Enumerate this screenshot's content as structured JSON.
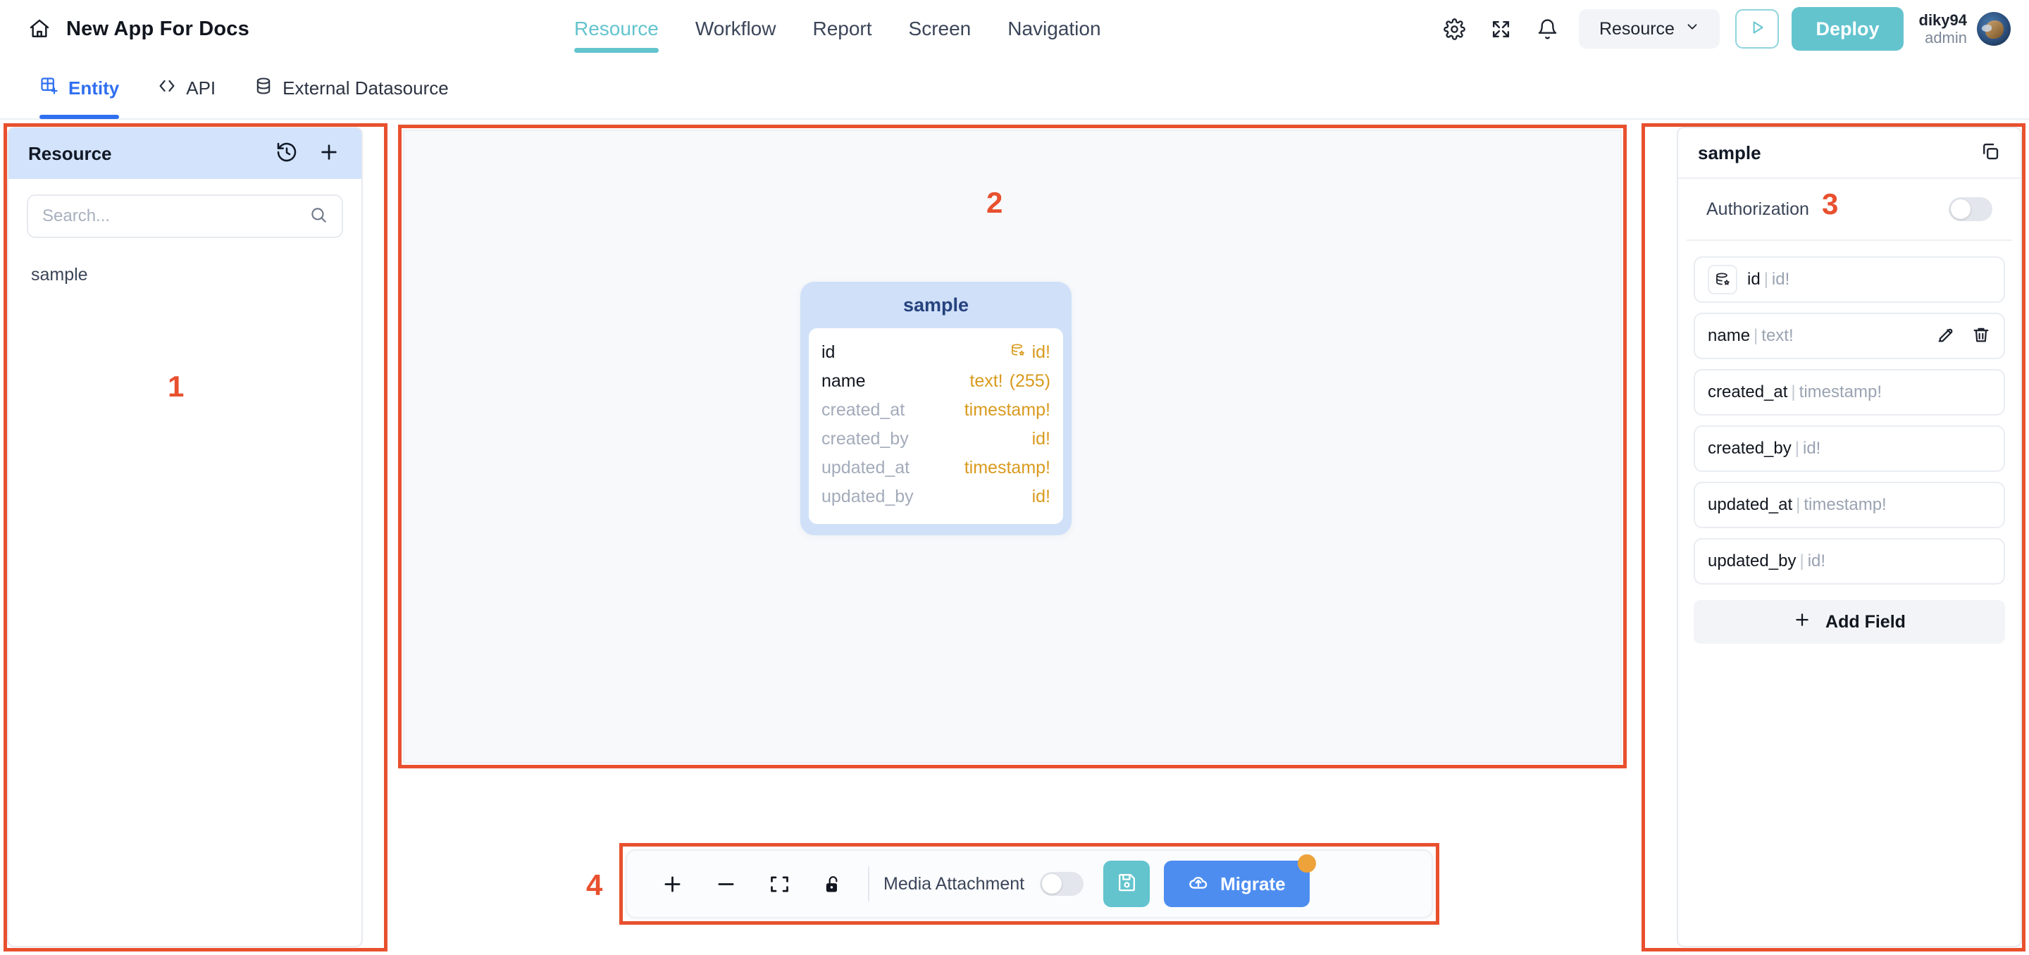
{
  "header": {
    "home_icon": "home-icon",
    "app_title": "New App For Docs",
    "nav": [
      {
        "label": "Resource",
        "active": true
      },
      {
        "label": "Workflow",
        "active": false
      },
      {
        "label": "Report",
        "active": false
      },
      {
        "label": "Screen",
        "active": false
      },
      {
        "label": "Navigation",
        "active": false
      }
    ],
    "settings_icon": "gear-icon",
    "fullscreen_icon": "expand-icon",
    "notifications_icon": "bell-icon",
    "resource_select": {
      "value": "Resource",
      "chevron": "chevron-down-icon"
    },
    "preview_icon": "play-icon",
    "deploy_label": "Deploy",
    "user": {
      "name": "diky94",
      "role": "admin",
      "avatar": "user-avatar"
    }
  },
  "subtabs": [
    {
      "label": "Entity",
      "icon": "entity-grid-icon",
      "active": true
    },
    {
      "label": "API",
      "icon": "code-icon",
      "active": false
    },
    {
      "label": "External Datasource",
      "icon": "database-icon",
      "active": false
    }
  ],
  "left_panel": {
    "title": "Resource",
    "history_icon": "history-icon",
    "add_icon": "plus-icon",
    "search": {
      "placeholder": "Search...",
      "value": "",
      "icon": "search-icon"
    },
    "items": [
      {
        "label": "sample"
      }
    ]
  },
  "canvas": {
    "entity": {
      "title": "sample",
      "fields": [
        {
          "name": "id",
          "type": "id!",
          "length": "",
          "muted": false,
          "icon": "primary-key-icon"
        },
        {
          "name": "name",
          "type": "text!",
          "length": "(255)",
          "muted": false,
          "icon": ""
        },
        {
          "name": "created_at",
          "type": "timestamp!",
          "length": "",
          "muted": true,
          "icon": ""
        },
        {
          "name": "created_by",
          "type": "id!",
          "length": "",
          "muted": true,
          "icon": ""
        },
        {
          "name": "updated_at",
          "type": "timestamp!",
          "length": "",
          "muted": true,
          "icon": ""
        },
        {
          "name": "updated_by",
          "type": "id!",
          "length": "",
          "muted": true,
          "icon": ""
        }
      ]
    }
  },
  "right_panel": {
    "title": "sample",
    "copy_icon": "copy-icon",
    "authorization": {
      "label": "Authorization",
      "enabled": false
    },
    "fields": [
      {
        "name": "id",
        "type": "id!",
        "chip_icon": "primary-key-icon",
        "tools": false
      },
      {
        "name": "name",
        "type": "text!",
        "chip_icon": "",
        "tools": true,
        "edit_icon": "edit-icon",
        "delete_icon": "trash-icon"
      },
      {
        "name": "created_at",
        "type": "timestamp!",
        "chip_icon": "",
        "tools": false
      },
      {
        "name": "created_by",
        "type": "id!",
        "chip_icon": "",
        "tools": false
      },
      {
        "name": "updated_at",
        "type": "timestamp!",
        "chip_icon": "",
        "tools": false
      },
      {
        "name": "updated_by",
        "type": "id!",
        "chip_icon": "",
        "tools": false
      }
    ],
    "add_field_label": "Add Field",
    "add_field_icon": "plus-icon"
  },
  "bottom_toolbar": {
    "zoom_in_icon": "plus-icon",
    "zoom_out_icon": "minus-icon",
    "fit_icon": "fit-screen-icon",
    "lock_icon": "unlock-icon",
    "media_attachment": {
      "label": "Media Attachment",
      "enabled": false
    },
    "save_icon": "save-disk-icon",
    "migrate": {
      "label": "Migrate",
      "icon": "cloud-upload-icon",
      "badge": true
    }
  },
  "annotations": [
    {
      "number": "1"
    },
    {
      "number": "2"
    },
    {
      "number": "3"
    },
    {
      "number": "4"
    }
  ],
  "colors": {
    "accent_teal": "#63c4ce",
    "accent_blue": "#2f6ff0",
    "migrate_blue": "#4d8df0",
    "annotation_red": "#e8502e",
    "entity_header_blue": "#cfe0f8",
    "type_amber": "#d99a1e",
    "badge_orange": "#eda23a"
  }
}
